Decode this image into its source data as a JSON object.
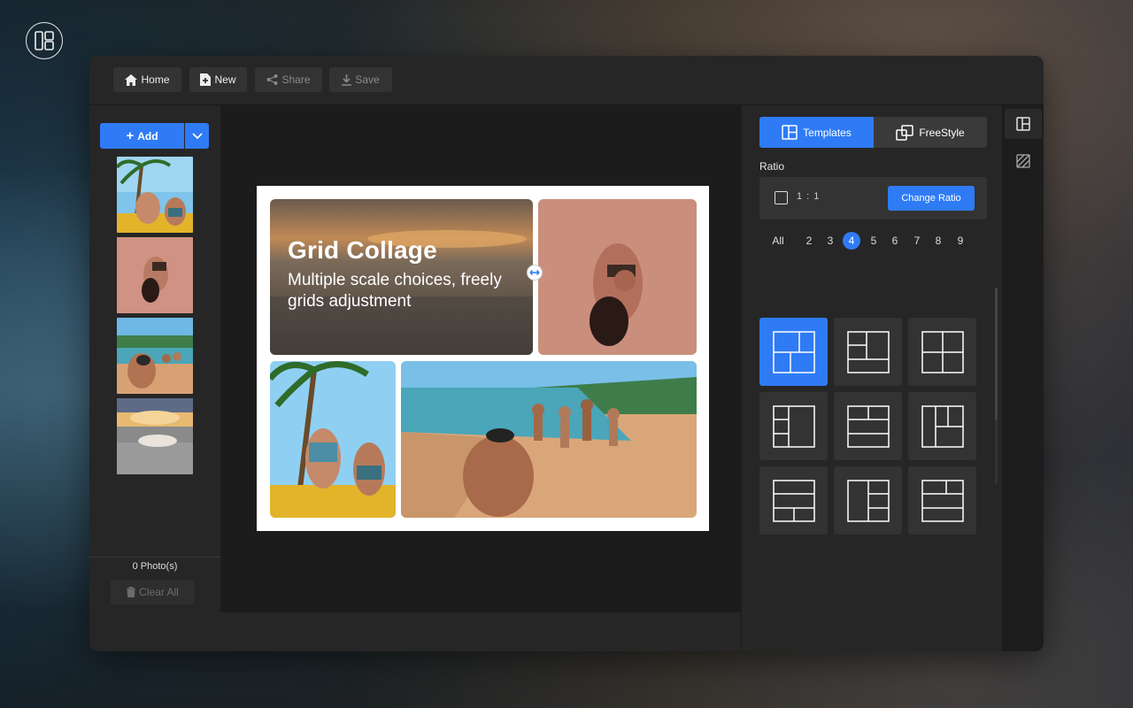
{
  "toolbar": {
    "home_label": "Home",
    "new_label": "New",
    "share_label": "Share",
    "save_label": "Save"
  },
  "left_panel": {
    "add_label": "Add",
    "photo_count": "0 Photo(s)",
    "clear_all_label": "Clear All"
  },
  "collage": {
    "title": "Grid Collage",
    "subtitle": "Multiple scale choices, freely grids adjustment"
  },
  "right_panel": {
    "templates_tab": "Templates",
    "freestyle_tab": "FreeStyle",
    "ratio_label": "Ratio",
    "ratio_value": "1 : 1",
    "change_ratio_label": "Change Ratio",
    "photo_counts": [
      "All",
      "2",
      "3",
      "4",
      "5",
      "6",
      "7",
      "8",
      "9"
    ],
    "selected_count": "4",
    "selected_template_index": 0
  },
  "colors": {
    "accent": "#2f7bf5",
    "window_bg": "#1d1d1d",
    "panel_bg": "#262626"
  },
  "icons": {
    "app_logo": "layout-grid-icon",
    "home": "home-icon",
    "new": "new-file-icon",
    "share": "share-icon",
    "save": "save-icon",
    "templates": "layout-icon",
    "freestyle": "overlap-icon",
    "rail_layout": "layout-icon",
    "rail_background": "hatch-icon"
  }
}
